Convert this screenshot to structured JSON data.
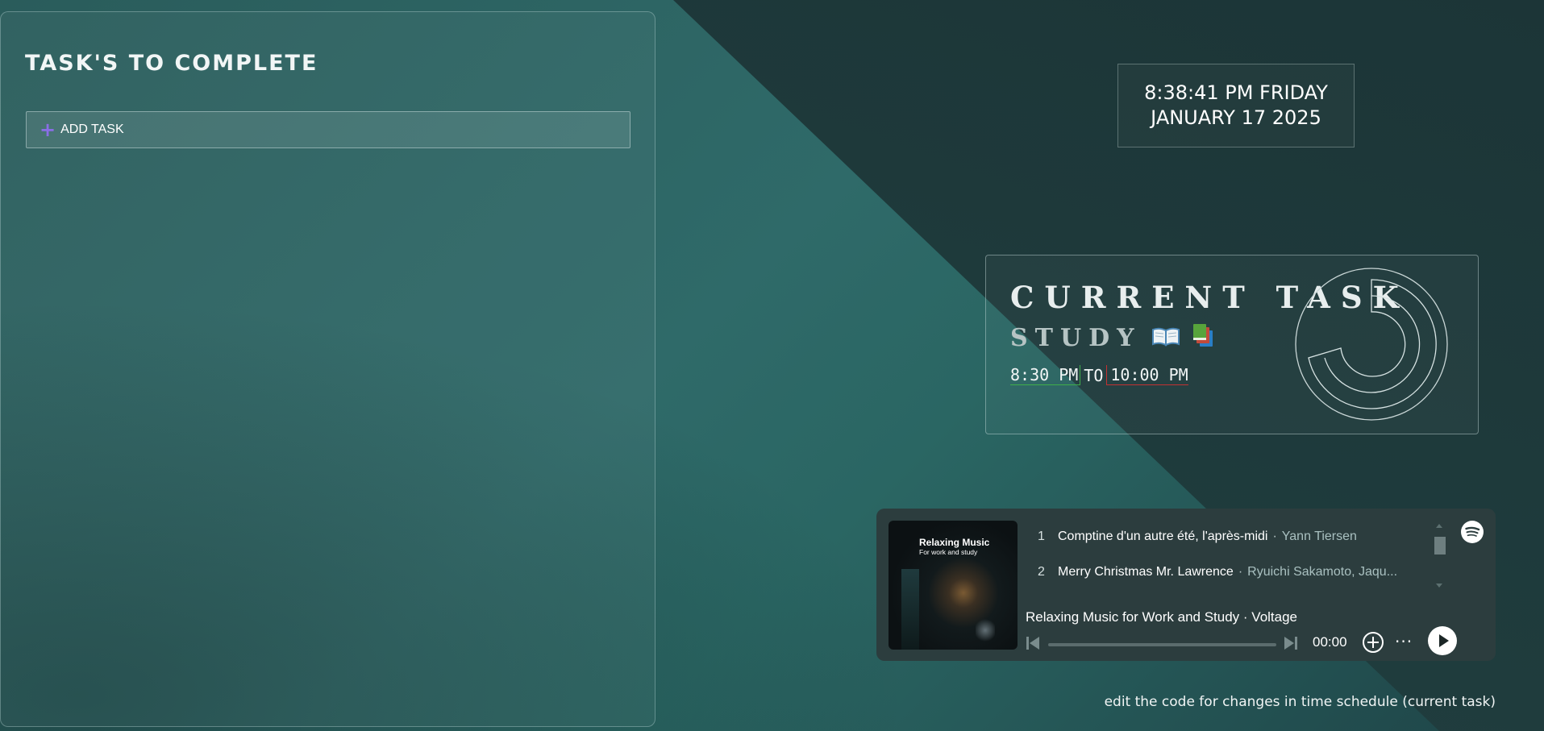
{
  "tasks_panel": {
    "title": "TASK'S TO COMPLETE",
    "add_task_label": "ADD TASK",
    "add_icon": "plus-icon"
  },
  "clock": {
    "time_line": "8:38:41 PM FRIDAY",
    "date_line": "JANUARY 17 2025"
  },
  "current_task": {
    "heading": "CURRENT TASK",
    "task_name": "STUDY",
    "icons": [
      "open-book-icon",
      "books-icon"
    ],
    "start_time": "8:30 PM",
    "separator": "TO",
    "end_time": "10:00 PM",
    "start_color": "#3fae4a",
    "end_color": "#c23232"
  },
  "player": {
    "cover_title": "Relaxing Music",
    "cover_subtitle": "For work and study",
    "tracks": [
      {
        "num": "1",
        "title": "Comptine d'un autre été, l'après-midi",
        "sep": "·",
        "artist": "Yann Tiersen"
      },
      {
        "num": "2",
        "title": "Merry Christmas Mr. Lawrence",
        "sep": "·",
        "artist": "Ryuichi Sakamoto, Jaqu..."
      }
    ],
    "now_playing": "Relaxing Music for Work and Study · Voltage",
    "time": "00:00",
    "progress": 0,
    "icons": [
      "spotify-icon",
      "previous-icon",
      "next-icon",
      "add-icon",
      "more-icon",
      "play-icon"
    ]
  },
  "footer_note": "edit the code for changes in time schedule (current task)"
}
